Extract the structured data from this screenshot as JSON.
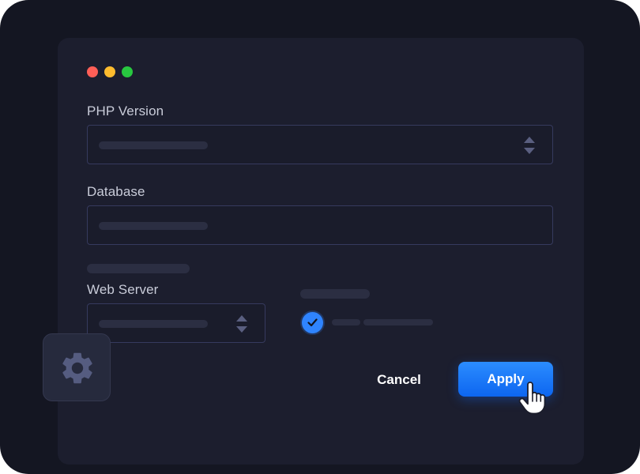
{
  "window": {
    "controls": [
      "close",
      "minimize",
      "maximize"
    ]
  },
  "form": {
    "php_version": {
      "label": "PHP Version",
      "control": "select"
    },
    "database": {
      "label": "Database",
      "control": "text"
    },
    "web_server": {
      "label": "Web Server",
      "control": "select"
    },
    "option": {
      "checked": true
    }
  },
  "actions": {
    "cancel_label": "Cancel",
    "apply_label": "Apply"
  },
  "icons": {
    "settings": "gear-icon",
    "checkbox": "checkmark-icon",
    "stepper": "chevron-up-down-icon",
    "pointer": "hand-pointer-icon"
  },
  "colors": {
    "background": "#141622",
    "panel": "#1c1e2e",
    "field_border": "#363a5e",
    "accent": "#1a78ff",
    "close": "#ff5f57",
    "minimize": "#febc2e",
    "maximize": "#28c840"
  }
}
